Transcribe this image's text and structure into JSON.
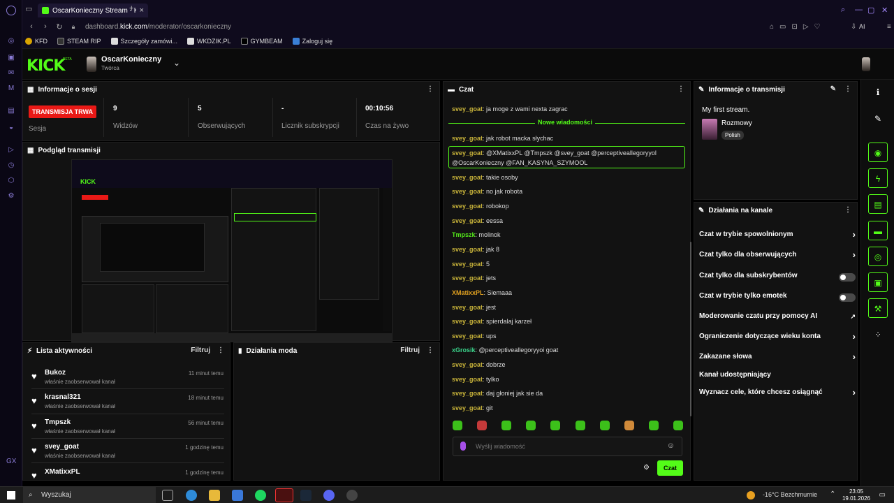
{
  "browser": {
    "tab_title": "OscarKonieczny Stream - Kick",
    "url_prefix": "dashboard.",
    "url_domain": "kick.com",
    "url_path": "/moderator/oscarkonieczny",
    "ai_label": "AI"
  },
  "bookmarks": [
    "KFD",
    "STEAM RIP",
    "Szczegóły zamówi...",
    "WKDZIK.PL",
    "GYMBEAM",
    "Zaloguj się"
  ],
  "header": {
    "logo": "KICK",
    "beta": "BETA",
    "channel": "OscarKonieczny",
    "role": "Twórca"
  },
  "session": {
    "title": "Informacje o sesji",
    "live_badge": "TRANSMISJA TRWA",
    "live_label": "Sesja",
    "stats": [
      {
        "value": "9",
        "label": "Widzów"
      },
      {
        "value": "5",
        "label": "Obserwujących"
      },
      {
        "value": "-",
        "label": "Licznik subskrypcji"
      },
      {
        "value": "00:10:56",
        "label": "Czas na żywo"
      }
    ]
  },
  "preview": {
    "title": "Podgląd transmisji"
  },
  "activity": {
    "title": "Lista aktywności",
    "filter": "Filtruj",
    "items": [
      {
        "name": "Bukoz",
        "sub": "właśnie zaobserwował kanał",
        "time": "11 minut temu"
      },
      {
        "name": "krasnal321",
        "sub": "właśnie zaobserwował kanał",
        "time": "18 minut temu"
      },
      {
        "name": "Tmpszk",
        "sub": "właśnie zaobserwował kanał",
        "time": "56 minut temu"
      },
      {
        "name": "svey_goat",
        "sub": "właśnie zaobserwował kanał",
        "time": "1 godzinę temu"
      },
      {
        "name": "XMatixxPL",
        "sub": "",
        "time": "1 godzinę temu"
      }
    ]
  },
  "modactions": {
    "title": "Działania moda",
    "filter": "Filtruj"
  },
  "chat": {
    "title": "Czat",
    "new_messages": "Nowe wiadomości",
    "input_placeholder": "Wyślij wiadomość",
    "send": "Czat",
    "messages": [
      {
        "user": "svey_goat",
        "text": "ja moge z wami nexta zagrac",
        "color": "#c9b43a"
      },
      {
        "user": "svey_goat",
        "text": "jak robot macka słychac",
        "color": "#c9b43a"
      },
      {
        "user": "svey_goat",
        "text": "@XMatixxPL @Tmpszk @svey_goat @perceptiveallegoryyol",
        "text2": "@OscarKonieczny @FAN_KASYNA_SZYMOOL",
        "color": "#c9b43a"
      },
      {
        "user": "svey_goat",
        "text": "takie osoby",
        "color": "#c9b43a"
      },
      {
        "user": "svey_goat",
        "text": "no jak robota",
        "color": "#c9b43a"
      },
      {
        "user": "svey_goat",
        "text": "robokop",
        "color": "#c9b43a"
      },
      {
        "user": "svey_goat",
        "text": "eessa",
        "color": "#c9b43a"
      },
      {
        "user": "Tmpszk",
        "text": "molinok",
        "color": "#53e61a"
      },
      {
        "user": "svey_goat",
        "text": "jak 8",
        "color": "#c9b43a"
      },
      {
        "user": "svey_goat",
        "text": "5",
        "color": "#c9b43a"
      },
      {
        "user": "svey_goat",
        "text": "jets",
        "color": "#c9b43a"
      },
      {
        "user": "XMatixxPL",
        "text": "Siemaaa",
        "color": "#e0a020"
      },
      {
        "user": "svey_goat",
        "text": "jest",
        "color": "#c9b43a"
      },
      {
        "user": "svey_goat",
        "text": "spierdalaj karzeł",
        "color": "#c9b43a"
      },
      {
        "user": "svey_goat",
        "text": "ups",
        "color": "#c9b43a"
      },
      {
        "user": "xGrosik",
        "text": "@perceptiveallegoryyoi goat",
        "color": "#3ad28a"
      },
      {
        "user": "svey_goat",
        "text": "dobrze",
        "color": "#c9b43a"
      },
      {
        "user": "svey_goat",
        "text": "tylko",
        "color": "#c9b43a"
      },
      {
        "user": "svey_goat",
        "text": "daj głoniej jak sie da",
        "color": "#c9b43a"
      },
      {
        "user": "svey_goat",
        "text": "git",
        "color": "#c9b43a"
      }
    ]
  },
  "stream_info": {
    "title": "Informacje o transmisji",
    "stream_title": "My first stream.",
    "category": "Rozmowy",
    "language": "Polish"
  },
  "channel_actions": {
    "title": "Działania na kanale",
    "items": [
      {
        "label": "Czat w trybie spowolnionym",
        "kind": "chevron"
      },
      {
        "label": "Czat tylko dla obserwujących",
        "kind": "chevron"
      },
      {
        "label": "Czat tylko dla subskrybentów",
        "kind": "toggle"
      },
      {
        "label": "Czat w trybie tylko emotek",
        "kind": "toggle"
      },
      {
        "label": "Moderowanie czatu przy pomocy AI",
        "kind": "external"
      },
      {
        "label": "Ograniczenie dotyczące wieku konta",
        "kind": "chevron"
      },
      {
        "label": "Zakazane słowa",
        "kind": "chevron"
      },
      {
        "label": "Kanał udostępniający",
        "kind": "none"
      },
      {
        "label": "Wyznacz cele, które chcesz osiągnąć",
        "kind": "chevron"
      }
    ]
  },
  "taskbar": {
    "search": "Wyszukaj",
    "weather": "-16°C  Bezchmurnie",
    "time": "23:05",
    "date": "19.01.2026"
  },
  "colors": {
    "accent": "#53fc18",
    "live": "#e91916"
  }
}
